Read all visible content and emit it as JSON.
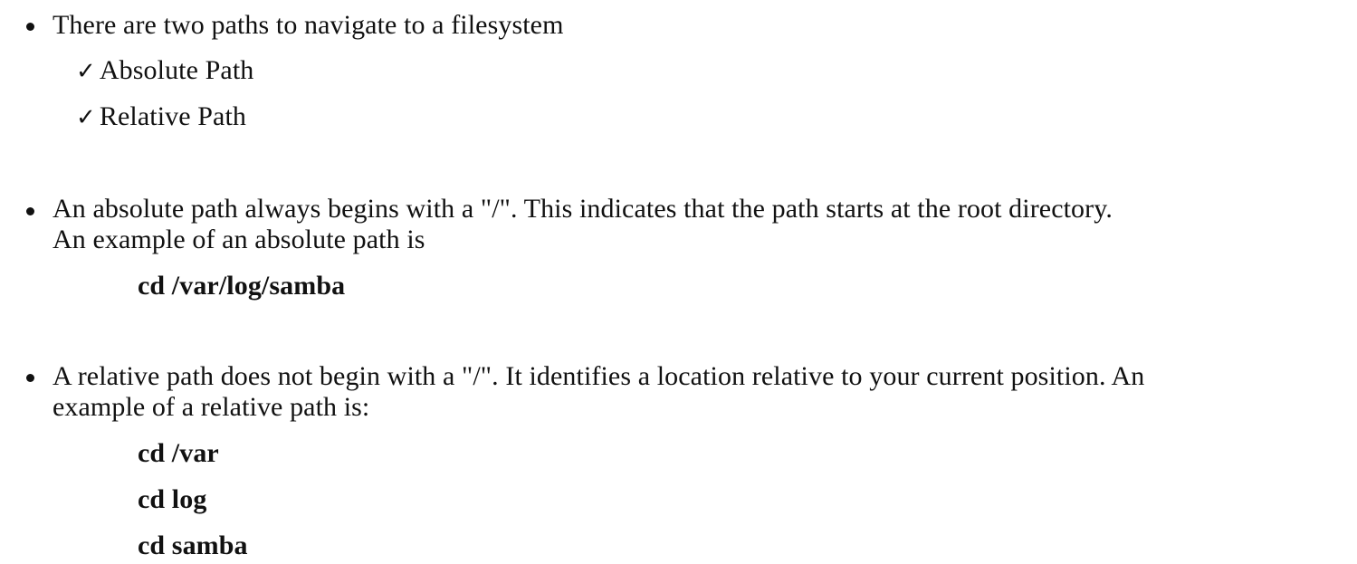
{
  "bullets": [
    {
      "text": "There are two paths to navigate to a filesystem",
      "sub_items": [
        {
          "check": "✓",
          "label": "Absolute Path"
        },
        {
          "check": "✓",
          "label": "Relative Path"
        }
      ]
    },
    {
      "line1": "An absolute path always begins with a \"/\".  This indicates that the path starts at the root directory.",
      "line2": "An example of an absolute path is",
      "code": [
        "cd /var/log/samba"
      ]
    },
    {
      "line1": "A relative path does not begin with a \"/\".  It identifies a location relative to your current position. An",
      "line2": "example of a relative path is:",
      "code": [
        "cd /var",
        "cd log",
        "cd samba"
      ]
    }
  ]
}
